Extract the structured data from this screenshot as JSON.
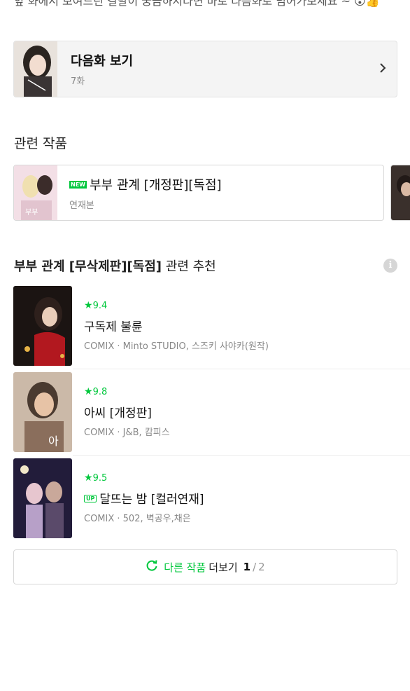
{
  "top_text": "앞 화에서 보여드린 결말이 궁금하시다면 바로 다음화로 넘어가보세요 ~ 😮👍",
  "next_episode": {
    "title": "다음화 보기",
    "subtitle": "7화"
  },
  "related_section": {
    "title": "관련 작품",
    "items": [
      {
        "badge": "NEW",
        "title": "부부 관계 [개정판][독점]",
        "subtitle": "연재본"
      }
    ]
  },
  "recommend_section": {
    "title_bold": "부부 관계 [무삭제판][독점]",
    "title_rest": " 관련 추천",
    "info_icon": "i",
    "items": [
      {
        "rating": "9.4",
        "title": "구독제 불륜",
        "meta": "COMIX · Minto STUDIO, 스즈키 사야카(원작)",
        "badge": ""
      },
      {
        "rating": "9.8",
        "title": "아씨 [개정판]",
        "meta": "COMIX · J&B, 캄피스",
        "badge": ""
      },
      {
        "rating": "9.5",
        "title": "달뜨는 밤 [컬러연재]",
        "meta": "COMIX · 502, 벽공우,채은",
        "badge": "UP"
      }
    ]
  },
  "more_button": {
    "green_label": "다른 작품",
    "dark_label": "더보기",
    "page_current": "1",
    "page_sep": "/",
    "page_total": "2"
  },
  "colors": {
    "accent": "#00c73c"
  },
  "icons": {
    "chevron": "chevron-right-icon",
    "refresh": "refresh-icon",
    "star": "star-icon"
  }
}
